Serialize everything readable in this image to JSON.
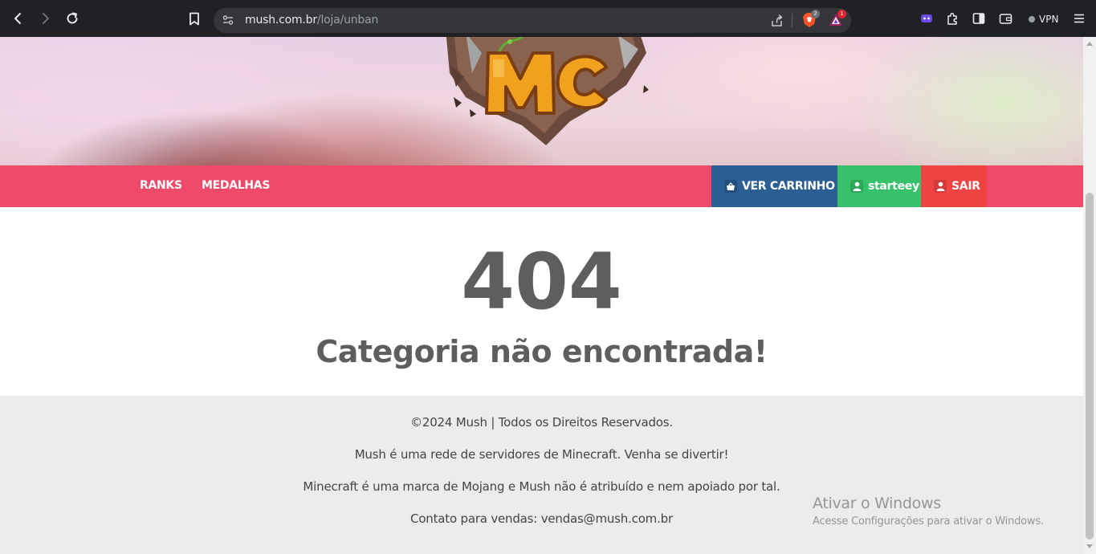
{
  "browser": {
    "url_domain": "mush.com.br",
    "url_path": "/loja/unban",
    "brave_badge_count": "2",
    "alert_badge_count": "1",
    "vpn_label": "VPN",
    "icons": [
      "back-icon",
      "forward-icon",
      "reload-icon",
      "bookmark-icon",
      "site-settings-icon",
      "share-icon",
      "brave-shields-icon",
      "brave-rewards-icon",
      "leo-icon",
      "extensions-icon",
      "sidebar-icon",
      "wallet-icon",
      "menu-icon"
    ]
  },
  "nav": {
    "links": [
      {
        "label": "RANKS"
      },
      {
        "label": "MEDALHAS"
      }
    ],
    "cart_label": "VER CARRINHO",
    "user_label": "starteey",
    "logout_label": "SAIR",
    "colors": {
      "bar": "#ef4a6a",
      "cart": "#2b5f94",
      "user": "#36c26a",
      "logout": "#f04444"
    }
  },
  "main": {
    "code": "404",
    "message": "Categoria não encontrada!"
  },
  "footer": {
    "lines": [
      "©2024 Mush | Todos os Direitos Reservados.",
      "Mush é uma rede de servidores de Minecraft. Venha se divertir!",
      "Minecraft é uma marca de Mojang e Mush não é atribuído e nem apoiado por tal.",
      "Contato para vendas: vendas@mush.com.br"
    ]
  },
  "watermark": {
    "title": "Ativar o Windows",
    "subtitle": "Acesse Configurações para ativar o Windows."
  }
}
